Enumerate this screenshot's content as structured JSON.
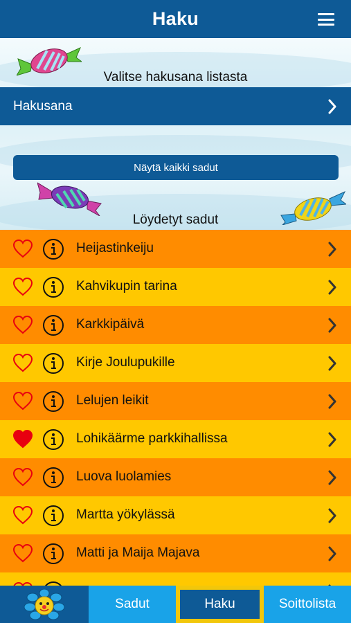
{
  "header": {
    "title": "Haku",
    "menu_icon": "hamburger-menu-icon"
  },
  "search": {
    "prompt": "Valitse hakusana listasta",
    "keyword_label": "Hakusana",
    "show_all_label": "Näytä kaikki sadut",
    "found_label": "Löydetyt sadut"
  },
  "stories": [
    {
      "title": "Heijastinkeiju",
      "favorite": false,
      "color": "#ff8c00"
    },
    {
      "title": "Kahvikupin tarina",
      "favorite": false,
      "color": "#ffc800"
    },
    {
      "title": "Karkkipäivä",
      "favorite": false,
      "color": "#ff8c00"
    },
    {
      "title": "Kirje Joulupukille",
      "favorite": false,
      "color": "#ffc800"
    },
    {
      "title": "Lelujen leikit",
      "favorite": false,
      "color": "#ff8c00"
    },
    {
      "title": "Lohikäärme parkkihallissa",
      "favorite": true,
      "color": "#ffc800"
    },
    {
      "title": "Luova luolamies",
      "favorite": false,
      "color": "#ff8c00"
    },
    {
      "title": "Martta yökylässä",
      "favorite": false,
      "color": "#ffc800"
    },
    {
      "title": "Matti ja Maija Majava",
      "favorite": false,
      "color": "#ff8c00"
    },
    {
      "title": "",
      "favorite": false,
      "color": "#ffc800"
    }
  ],
  "tabbar": {
    "home_icon": "sun-flower-icon",
    "sadut_label": "Sadut",
    "haku_label": "Haku",
    "soittolista_label": "Soittolista"
  },
  "colors": {
    "primary_blue": "#0e5a96",
    "tab_blue": "#19a3e8",
    "row_orange": "#ff8c00",
    "row_yellow": "#ffc800",
    "heart_red": "#e8000f"
  }
}
